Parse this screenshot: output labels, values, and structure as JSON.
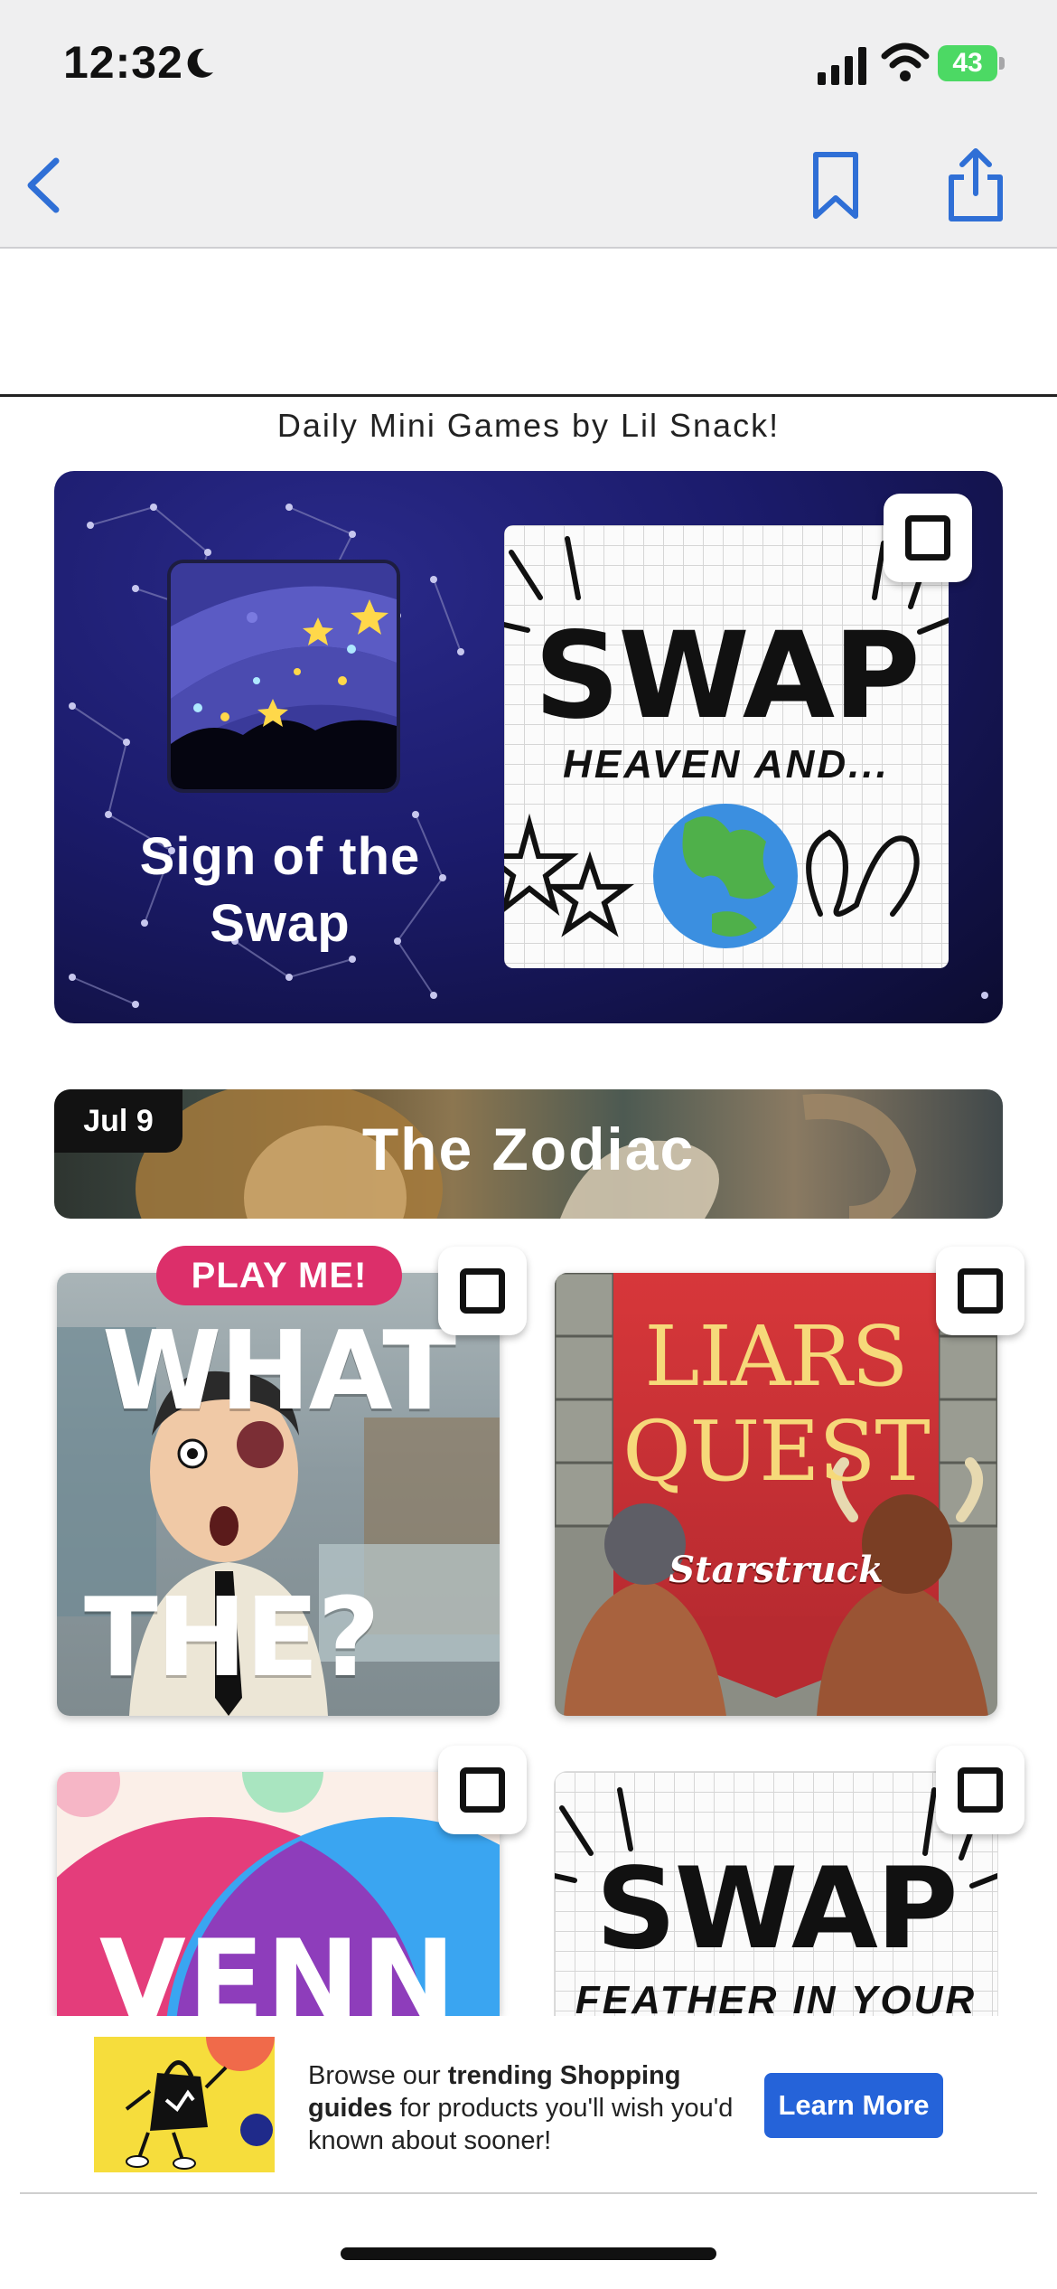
{
  "status_bar": {
    "time": "12:32",
    "battery": "43"
  },
  "nav": {
    "back": "back",
    "bookmark": "bookmark",
    "share": "share"
  },
  "page": {
    "headline": "Daily Mini Games by Lil Snack!"
  },
  "feature": {
    "title_line1": "Sign of the",
    "title_line2": "Swap",
    "card_title": "SWAP",
    "card_subtitle": "HEAVEN AND..."
  },
  "section": {
    "date": "Jul 9",
    "title": "The Zodiac"
  },
  "tiles": [
    {
      "badge": "PLAY ME!",
      "line1": "WHAT",
      "line2": "THE?"
    },
    {
      "title_line1": "LIARS",
      "title_line2": "QUEST",
      "subtitle": "Starstruck"
    },
    {
      "title": "VENN"
    },
    {
      "title": "SWAP",
      "subtitle": "FEATHER IN YOUR"
    }
  ],
  "ad": {
    "text_1": "Browse our ",
    "text_bold_1": "trending Shopping",
    "text_bold_2": "guides",
    "text_2": " for products you'll wish you'd known about sooner!",
    "button": "Learn More"
  },
  "colors": {
    "accent_blue": "#2563d9",
    "play_pink": "#dc2f6a",
    "battery_green": "#4cd964",
    "nav_blue": "#2f6fd6"
  }
}
